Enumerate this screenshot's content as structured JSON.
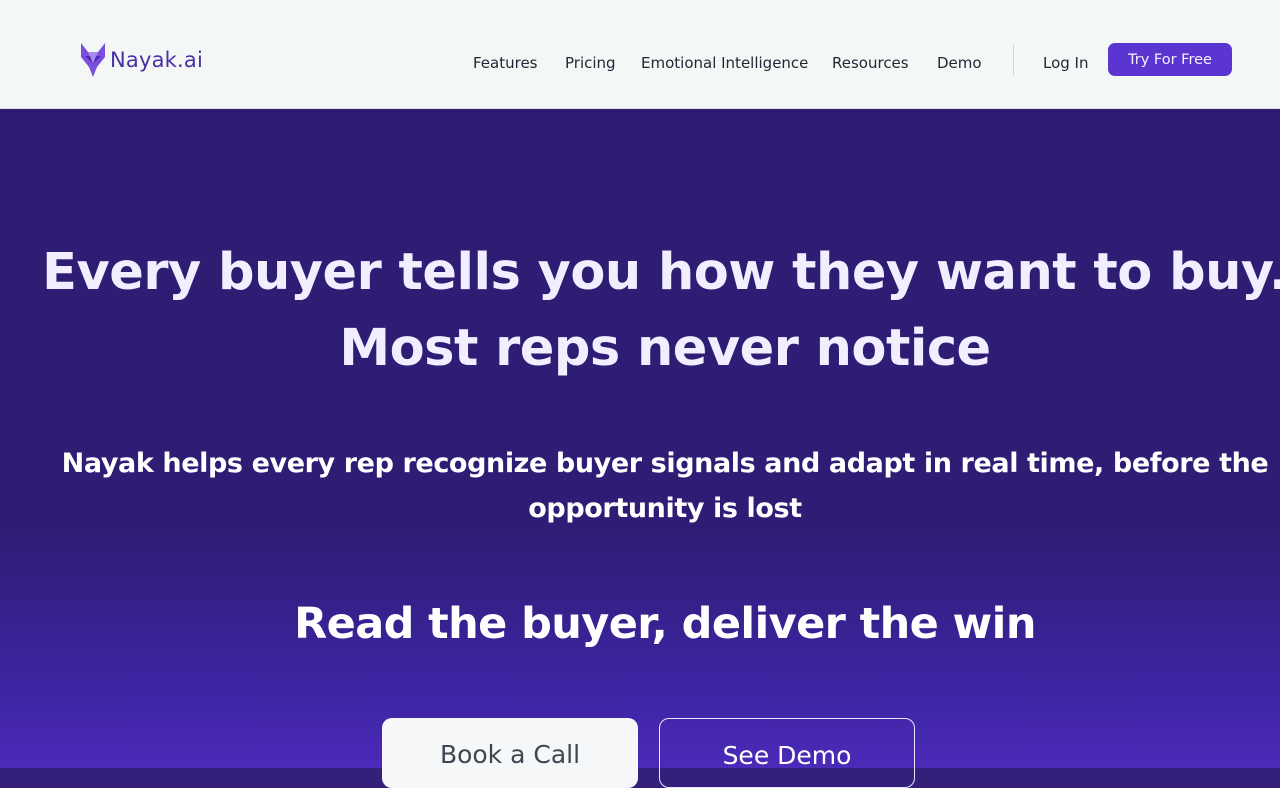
{
  "brand": {
    "name": "Nayak.ai",
    "accent_color": "#5b35cf",
    "logo_icon": "fox-head-logo-icon"
  },
  "nav": {
    "items": [
      {
        "label": "Features"
      },
      {
        "label": "Pricing"
      },
      {
        "label": "Emotional Intelligence"
      },
      {
        "label": "Resources"
      },
      {
        "label": "Demo"
      }
    ],
    "login_label": "Log In",
    "cta_label": "Try For Free"
  },
  "hero": {
    "headline_line1": "Every buyer tells you how they want to buy.",
    "headline_line2": "Most reps never notice",
    "subhead": "Nayak helps every rep recognize buyer signals and adapt in real time, before the opportunity is lost",
    "tagline": "Read the buyer, deliver the win",
    "primary_button": "Book a Call",
    "secondary_button": "See Demo",
    "background_color": "#2f1b72"
  }
}
